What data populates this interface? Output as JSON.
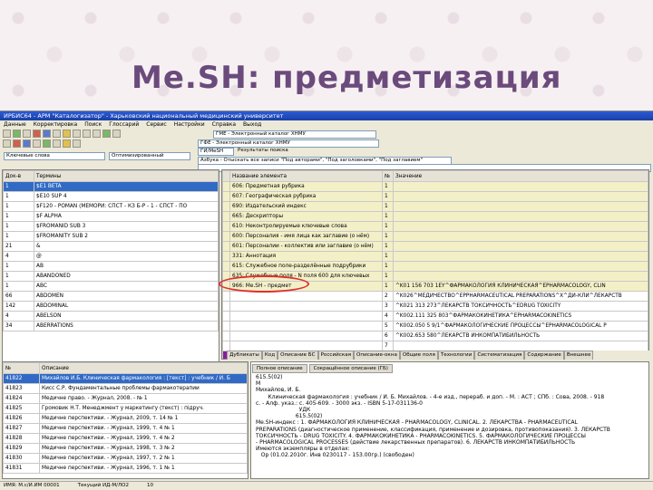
{
  "slide": {
    "title": "Me.SH: предметизация"
  },
  "app": {
    "window_title": "ИРБИС64 - АРМ \"Каталогизатор\" - Харьковский национальный медицинский университет",
    "menu": [
      "Данные",
      "Корректировка",
      "Поиск",
      "Глоссарий",
      "Сервис",
      "Настройки",
      "Справка",
      "Выход"
    ],
    "db_field": "ГМЕ - Электронный каталог ХНМУ",
    "search_field": "ГФЕ - Электронный каталог ХНМУ",
    "input_field": "ГИ/МеSН",
    "result_label": "Результаты поиска",
    "dict_field": "Ключевые слова",
    "sort_field": "Оптимизированный",
    "query_field": "Азбука - Отыскать все записи \"Под авторами\", \"Под заголовками\", \"Под заглавием\"",
    "left_table": {
      "headers": [
        "Док-в",
        "Термины"
      ],
      "rows": [
        [
          "1",
          "$E1 BETA"
        ],
        [
          "1",
          "$E10 SUP 4"
        ],
        [
          "1",
          "$F120 - POMAN (МЕМОРИ: СПСТ - КЗ Б-Р - 1 - СПСТ - ПО"
        ],
        [
          "1",
          "$F ALPHA"
        ],
        [
          "1",
          "$FROMANID SUB 3"
        ],
        [
          "1",
          "$FROMANITY SUB 2"
        ],
        [
          "21",
          "&"
        ],
        [
          "4",
          "@"
        ],
        [
          "1",
          "AB"
        ],
        [
          "1",
          "ABANDONED"
        ],
        [
          "1",
          "ABC"
        ],
        [
          "66",
          "ABDOMEN"
        ],
        [
          "142",
          "ABDOMINAL"
        ],
        [
          "4",
          "ABELSON"
        ],
        [
          "34",
          "ABERRATIONS"
        ]
      ]
    },
    "field_table": {
      "headers": [
        "Название элемента",
        "№",
        "Значение"
      ],
      "rows": [
        [
          "606: Предметная рубрика",
          "1",
          ""
        ],
        [
          "607: Географическая рубрика",
          "1",
          ""
        ],
        [
          "690: Издательский индекс",
          "1",
          ""
        ],
        [
          "665: Дескрипторы",
          "1",
          ""
        ],
        [
          "610: Неконтролируемые ключевые слова",
          "1",
          ""
        ],
        [
          "600: Персоналия - имя лица как заглавие (о нём)",
          "1",
          ""
        ],
        [
          "601: Персоналии - коллектив или заглавие (о нём)",
          "1",
          ""
        ],
        [
          "331: Аннотация",
          "1",
          ""
        ],
        [
          "615: Служебное поле-разделённые подрубрики",
          "1",
          ""
        ],
        [
          "635: Служебные поля - N поля 600 для ключевых",
          "1",
          ""
        ],
        [
          "966: Me.SH - предмет",
          "1",
          "^K01 156 703 1EY^ФАРМАКОЛОГИЯ КЛИНИЧЕСКАЯ^ЕPHARMACOLOGY, CLIN"
        ],
        [
          "",
          "2",
          "^K026^МЕДИЧЕСТВО^ЕРPHARMACEUTICAL PREPARATIONS^Х^ДИ-КЛИ^ЛЕКАРСТВ"
        ],
        [
          "",
          "3",
          "^K021 313 273^ЛЕКАРСТВ ТОКСИЧНОСТЬ^ЕDRUG TOXICITY"
        ],
        [
          "",
          "4",
          "^K002.111 325 803^ФАРМАКОКИНЕТИКА^ЕPHARMACOKINETICS"
        ],
        [
          "",
          "5",
          "^K002.050 5 9/1^ФАРМАКОЛОГИЧЕСКИЕ ПРОЦЕССЫ^ЕPHARMACOLOGICAL P"
        ],
        [
          "",
          "6",
          "^K002.653 580^ЛЕКАРСТВ ИНКОМПАТИБИЛЬНОСТЬ"
        ],
        [
          "",
          "7",
          ""
        ],
        [
          "995: Me.SH - негативная",
          "1",
          ""
        ]
      ]
    },
    "field_tabs": [
      "Дубликаты",
      "Код",
      "Описание БС",
      "Российская",
      "Описание-окна",
      "Общие поля",
      "Технологии",
      "Систематизация",
      "Содержание",
      "Внешнее"
    ],
    "records_table": {
      "headers": [
        "№",
        "Описание"
      ],
      "rows": [
        [
          "41822",
          "Михайлов И.Б. Клиническая фармакология : [текст] : учебник / И. Б"
        ],
        [
          "41823",
          "Кисс С.Р. Фундаментальные проблемы фармакотерапии"
        ],
        [
          "41824",
          "Медичне право. - Журнал, 2008. - № 1"
        ],
        [
          "41825",
          "Громовик Н.Т. Менеджмент у маркетингу (текст) : підруч."
        ],
        [
          "41826",
          "Медичне перспективи. - Журнал, 2009, т. 14 № 1"
        ],
        [
          "41827",
          "Медичне перспективи. - Журнал, 1999, т. 4 № 1"
        ],
        [
          "41828",
          "Медичне перспективи. - Журнал, 1999, т. 4 № 2"
        ],
        [
          "41829",
          "Медичне перспективи. - Журнал, 1998, т. 3 № 2"
        ],
        [
          "41830",
          "Медичне перспективи. - Журнал, 1997, т. 2 № 1"
        ],
        [
          "41831",
          "Медичне перспективи. - Журнал, 1996, т. 1 № 1"
        ]
      ]
    },
    "record_tabs": [
      "Полное описание",
      "Сокращённое описание (ГБ)"
    ],
    "record_text": [
      "615.5(02)",
      "М",
      "Михайлов, И. Б.",
      "       Клиническая фармакология : учебник / И. Б. Михайлов. - 4-е изд., перераб. и доп. - М. : АСТ ; СПб. : Сова, 2008. - 918",
      "с. - Алф. указ.: с. 405-609. - 3000 экз. - ISBN 5-17-031136-0",
      "                         УДК",
      "                       615.5(02)",
      "Me.SH-индекс : 1. ФАРМАКОЛОГИЯ КЛИНИЧЕСКАЯ - PHARMACOLOGY, CLINICAL. 2. ЛЕКАРСТВА - PHARMACEUTICAL",
      "PREPARATIONS (диагностическое применение, классификация, применение и дозировка, противопоказания). 3. ЛЕКАРСТВ",
      "ТОКСИЧНОСТЬ - DRUG TOXICITY. 4. ФАРМАКОКИНЕТИКА - PHARMACOKINETICS. 5. ФАРМАКОЛОГИЧЕСКИЕ ПРОЦЕССЫ",
      "- PHARMACOLOGICAL PROCESSES (действие лекарственных препаратов). 6. ЛЕКАРСТВ ИНКОМПАТИБИЛЬНОСТЬ",
      "Имеются экземпляры в отделах:",
      "   Ор (01.02.2010г. Инв 0230117 - 153.00гр.) (свободен)"
    ],
    "status": [
      "ИМЯ: М.с/И.ИМ 00001",
      "Текущий ИД-М/ЛО2",
      "10"
    ]
  }
}
